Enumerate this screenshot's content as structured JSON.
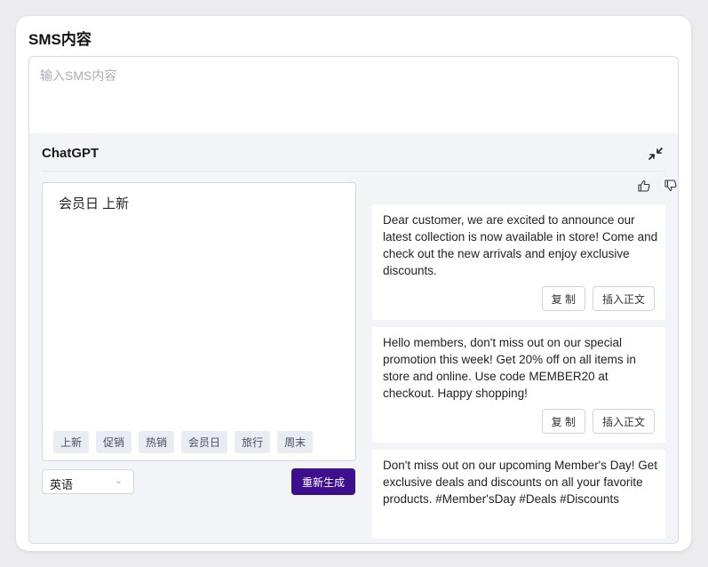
{
  "section": {
    "title": "SMS内容"
  },
  "sms_input": {
    "placeholder": "输入SMS内容",
    "value": ""
  },
  "chatgpt": {
    "title": "ChatGPT",
    "prompt": "会员日 上新",
    "tags": [
      "上新",
      "促销",
      "热销",
      "会员日",
      "旅行",
      "周末"
    ],
    "language": "英语",
    "regenerate_label": "重新生成",
    "results": [
      {
        "text": "Dear customer, we are excited to announce our latest collection is now available in store! Come and check out the new arrivals and enjoy exclusive discounts.",
        "copy_label": "复 制",
        "insert_label": "插入正文"
      },
      {
        "text": "Hello members, don't miss out on our special promotion this week! Get 20% off on all items in store and online. Use code MEMBER20 at checkout. Happy shopping!",
        "copy_label": "复 制",
        "insert_label": "插入正文"
      },
      {
        "text": "Don't miss out on our upcoming Member's Day! Get exclusive deals and discounts on all your favorite products. #Member'sDay #Deals #Discounts"
      }
    ]
  },
  "colors": {
    "accent": "#3d0f8e",
    "panel_bg": "#f3f4f8",
    "tag_bg": "#e9ecf2"
  },
  "icons": [
    "collapse-icon",
    "thumbs-up-icon",
    "thumbs-down-icon",
    "chevron-down-icon"
  ]
}
